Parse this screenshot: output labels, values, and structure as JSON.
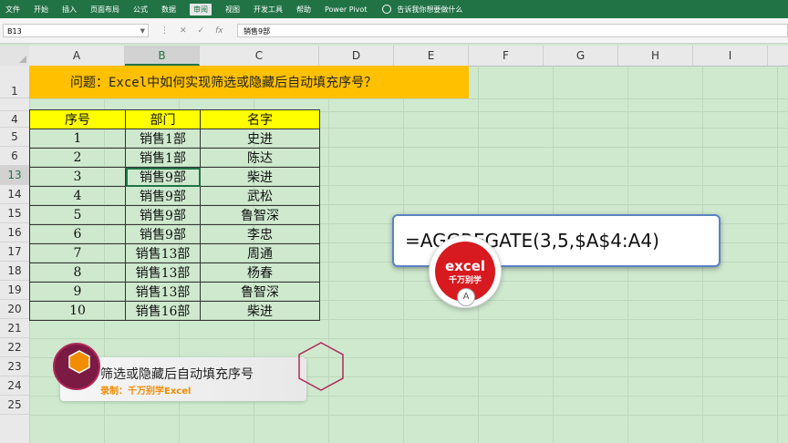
{
  "ribbon": {
    "tabs": [
      "文件",
      "开始",
      "插入",
      "页面布局",
      "公式",
      "数据",
      "审阅",
      "视图",
      "开发工具",
      "帮助",
      "Power Pivot"
    ],
    "active_tab": "审阅",
    "tell_me": "告诉我你想要做什么"
  },
  "formula_bar": {
    "name_box": "B13",
    "value": "销售9部",
    "fx_label": "fx"
  },
  "columns": [
    "A",
    "B",
    "C",
    "D",
    "E",
    "F",
    "G",
    "H",
    "I"
  ],
  "rows": [
    "1",
    "4",
    "5",
    "6",
    "13",
    "14",
    "15",
    "16",
    "17",
    "18",
    "19",
    "20",
    "21",
    "22",
    "23",
    "24",
    "25"
  ],
  "title": "问题：Excel中如何实现筛选或隐藏后自动填充序号？",
  "table": {
    "headers": [
      "序号",
      "部门",
      "名字"
    ],
    "rows": [
      [
        "1",
        "销售1部",
        "史进"
      ],
      [
        "2",
        "销售1部",
        "陈达"
      ],
      [
        "3",
        "销售9部",
        "柴进"
      ],
      [
        "4",
        "销售9部",
        "武松"
      ],
      [
        "5",
        "销售9部",
        "鲁智深"
      ],
      [
        "6",
        "销售9部",
        "李忠"
      ],
      [
        "7",
        "销售13部",
        "周通"
      ],
      [
        "8",
        "销售13部",
        "杨春"
      ],
      [
        "9",
        "销售13部",
        "鲁智深"
      ],
      [
        "10",
        "销售16部",
        "柴进"
      ]
    ]
  },
  "formula_callout": "=AGGREGATE(3,5,$A$4:A4)",
  "logo": {
    "top": "excel",
    "bottom": "千万别学",
    "badge": "A"
  },
  "banner": {
    "title": "筛选或隐藏后自动填充序号",
    "subtitle": "录制：千万别学Excel"
  },
  "colors": {
    "ribbon": "#217346",
    "title_fill": "#ffc000",
    "header_fill": "#ffff00",
    "sheet_bg": "#cfe9cf",
    "brand_red": "#d71920"
  }
}
